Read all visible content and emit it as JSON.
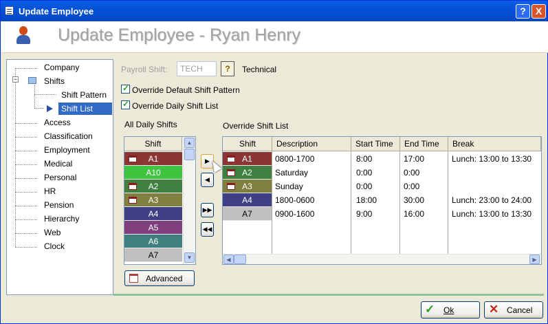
{
  "window": {
    "title": "Update Employee",
    "help_label": "?",
    "close_label": "X"
  },
  "header": {
    "title": "Update Employee - Ryan Henry"
  },
  "tree": {
    "items": [
      {
        "label": "Company"
      },
      {
        "label": "Shifts"
      },
      {
        "label": "Shift Pattern"
      },
      {
        "label": "Shift List"
      },
      {
        "label": "Access"
      },
      {
        "label": "Classification"
      },
      {
        "label": "Employment"
      },
      {
        "label": "Medical"
      },
      {
        "label": "Personal"
      },
      {
        "label": "HR"
      },
      {
        "label": "Pension"
      },
      {
        "label": "Hierarchy"
      },
      {
        "label": "Web"
      },
      {
        "label": "Clock"
      }
    ],
    "selected": "Shift List"
  },
  "payroll": {
    "label": "Payroll Shift:",
    "value": "TECH",
    "help_label": "?",
    "description": "Technical"
  },
  "options": {
    "override_pattern": {
      "label": "Override Default Shift Pattern",
      "checked": true
    },
    "override_list": {
      "label": "Override Daily Shift List",
      "checked": true
    }
  },
  "all_shifts": {
    "caption": "All Daily Shifts",
    "header": "Shift",
    "rows": [
      {
        "name": "A1",
        "color": "#8b3535",
        "icon": true,
        "light": false
      },
      {
        "name": "A10",
        "color": "#3fc43f",
        "icon": false,
        "light": false
      },
      {
        "name": "A2",
        "color": "#3f7f3f",
        "icon": true,
        "light": false
      },
      {
        "name": "A3",
        "color": "#7f7f3f",
        "icon": true,
        "light": false
      },
      {
        "name": "A4",
        "color": "#3f3f85",
        "icon": false,
        "light": false
      },
      {
        "name": "A5",
        "color": "#7f3f7f",
        "icon": false,
        "light": false
      },
      {
        "name": "A6",
        "color": "#3f7f7f",
        "icon": false,
        "light": false
      },
      {
        "name": "A7",
        "color": "#c0c0c0",
        "icon": false,
        "light": true
      }
    ]
  },
  "move_buttons": {
    "add": "▶",
    "remove": "◀",
    "add_all": "▶▶",
    "remove_all": "◀◀"
  },
  "advanced_label": "Advanced",
  "override_list": {
    "caption": "Override Shift List",
    "columns": [
      "Shift",
      "Description",
      "Start Time",
      "End Time",
      "Break"
    ],
    "rows": [
      {
        "shift": "A1",
        "color": "#8b3535",
        "icon": true,
        "light": false,
        "description": "0800-1700",
        "start": "8:00",
        "end": "17:00",
        "break": "Lunch: 13:00 to 13:30"
      },
      {
        "shift": "A2",
        "color": "#3f7f3f",
        "icon": true,
        "light": false,
        "description": "Saturday",
        "start": "0:00",
        "end": "0:00",
        "break": ""
      },
      {
        "shift": "A3",
        "color": "#7f7f3f",
        "icon": true,
        "light": false,
        "description": "Sunday",
        "start": "0:00",
        "end": "0:00",
        "break": ""
      },
      {
        "shift": "A4",
        "color": "#3f3f85",
        "icon": false,
        "light": false,
        "description": "1800-0600",
        "start": "18:00",
        "end": "30:00",
        "break": "Lunch: 23:00 to 24:00"
      },
      {
        "shift": "A7",
        "color": "#c0c0c0",
        "icon": false,
        "light": true,
        "description": "0900-1600",
        "start": "9:00",
        "end": "16:00",
        "break": "Lunch: 13:00 to 13:30"
      }
    ]
  },
  "footer": {
    "ok_label": "Ok",
    "cancel_label": "Cancel"
  }
}
